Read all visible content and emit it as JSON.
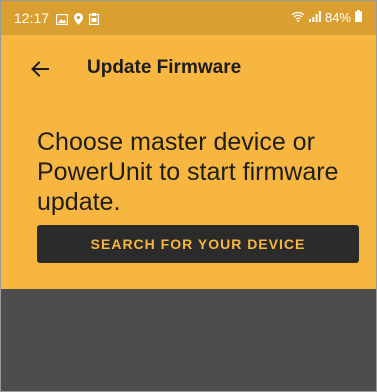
{
  "status_bar": {
    "time": "12:17",
    "battery": "84%",
    "left_icons": [
      "gallery-icon",
      "location-pin-icon",
      "clipboard-icon"
    ],
    "right_icons": [
      "wifi-icon",
      "signal-icon",
      "battery-icon"
    ]
  },
  "app_bar": {
    "title": "Update Firmware",
    "back_icon": "back-arrow-icon"
  },
  "main": {
    "headline": "Choose master device or PowerUnit to start firmware update.",
    "search_button_label": "SEARCH FOR YOUR DEVICE"
  },
  "colors": {
    "accent": "#f7b63f",
    "status_bar": "#d9a031",
    "button": "#2b2b2b",
    "lower_panel": "#4d4d4d"
  }
}
